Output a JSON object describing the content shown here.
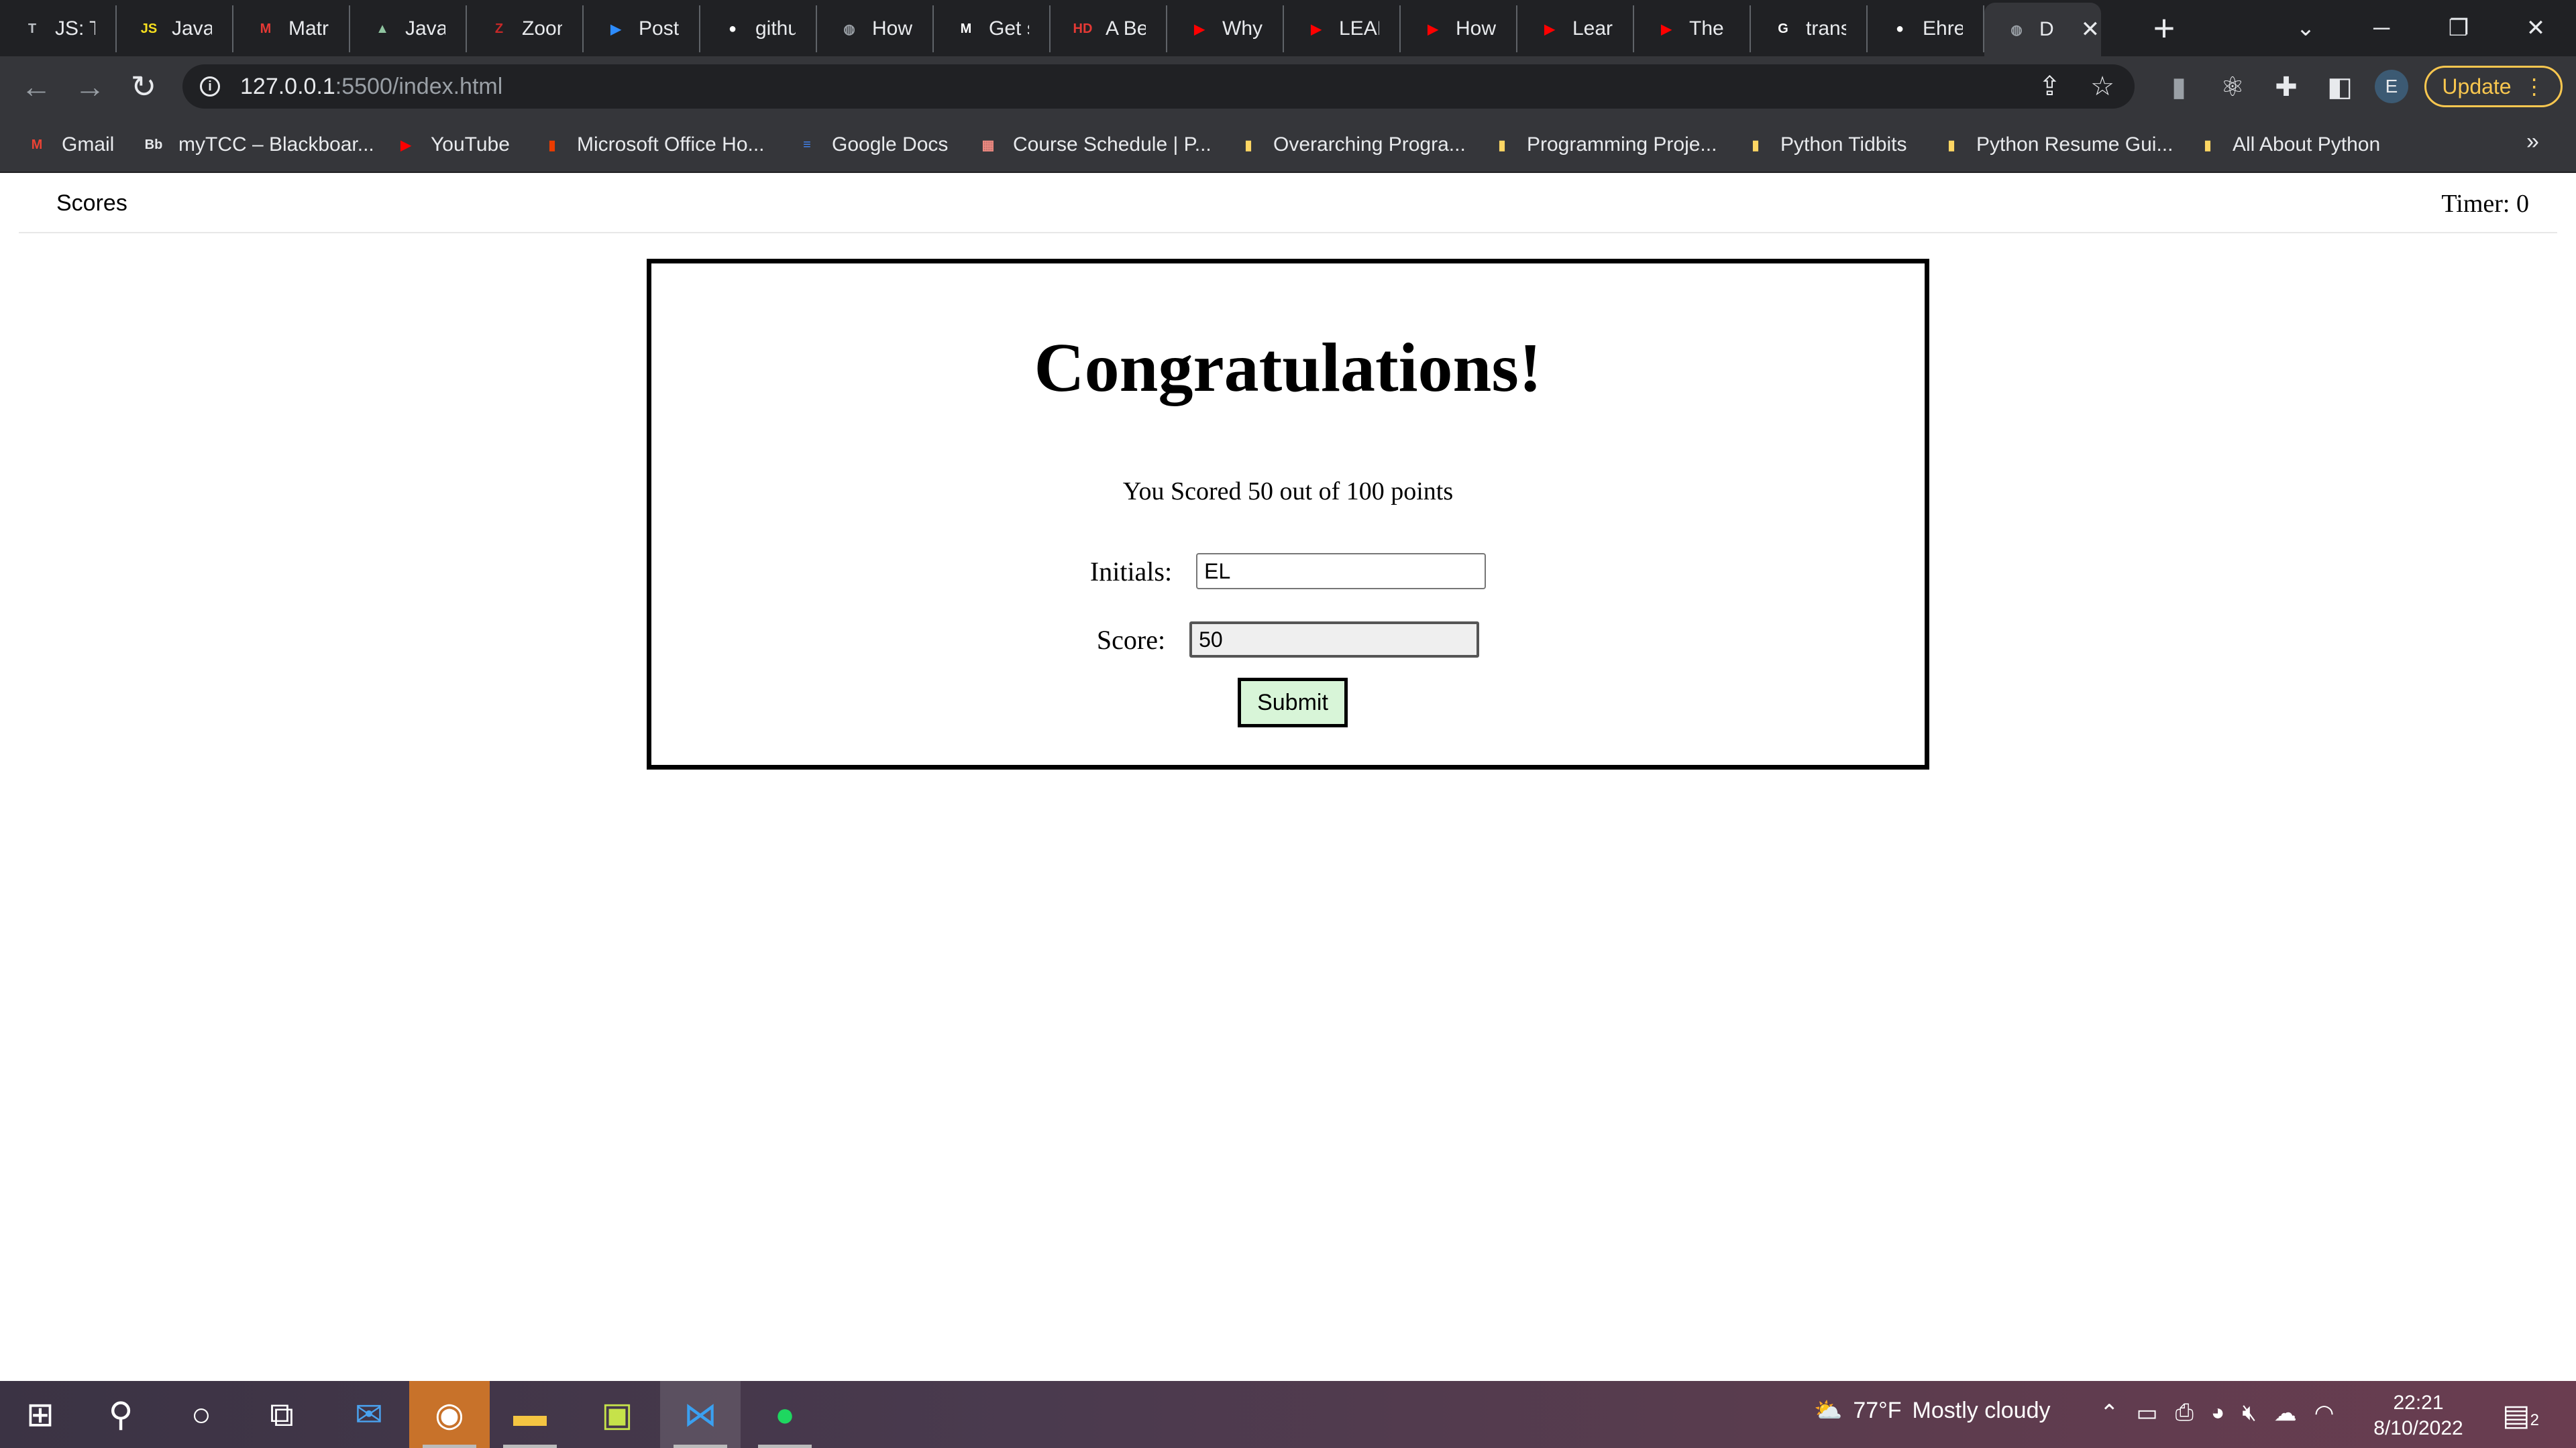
{
  "browser": {
    "tabs": [
      {
        "label": "JS: Tr",
        "icon": "T",
        "icon_color": "#bdc1c6"
      },
      {
        "label": "JavaS",
        "icon": "JS",
        "icon_color": "#f7df1e"
      },
      {
        "label": "Matri",
        "icon": "M",
        "icon_color": "#e53935"
      },
      {
        "label": "JavaS",
        "icon": "▲",
        "icon_color": "#8fc4a0"
      },
      {
        "label": "Zoom",
        "icon": "Z",
        "icon_color": "#c62828"
      },
      {
        "label": "Post /",
        "icon": "▶",
        "icon_color": "#2d8cff"
      },
      {
        "label": "githul",
        "icon": "●",
        "icon_color": "#ffffff"
      },
      {
        "label": "How",
        "icon": "◍",
        "icon_color": "#9aa0a6"
      },
      {
        "label": "Get st",
        "icon": "M",
        "icon_color": "#ffffff"
      },
      {
        "label": "A Beg",
        "icon": "HD",
        "icon_color": "#e53935"
      },
      {
        "label": "Why",
        "icon": "▶",
        "icon_color": "#ff0000"
      },
      {
        "label": "LEARI",
        "icon": "▶",
        "icon_color": "#ff0000"
      },
      {
        "label": "How",
        "icon": "▶",
        "icon_color": "#ff0000"
      },
      {
        "label": "Learn",
        "icon": "▶",
        "icon_color": "#ff0000"
      },
      {
        "label": "The R",
        "icon": "▶",
        "icon_color": "#ff0000"
      },
      {
        "label": "transl",
        "icon": "G",
        "icon_color": "#ffffff"
      },
      {
        "label": "Ehren",
        "icon": "●",
        "icon_color": "#ffffff"
      }
    ],
    "active_tab": {
      "label": "D",
      "icon": "◍"
    },
    "new_tab_symbol": "+",
    "address": {
      "host": "127.0.0.1",
      "path": ":5500/index.html"
    },
    "profile_initial": "E",
    "update_label": "Update",
    "bookmarks": [
      {
        "label": "Gmail",
        "icon": "M",
        "icon_color": "#ea4335"
      },
      {
        "label": "myTCC – Blackboar...",
        "icon": "Bb",
        "icon_color": "#e8eaed"
      },
      {
        "label": "YouTube",
        "icon": "▶",
        "icon_color": "#ff0000"
      },
      {
        "label": "Microsoft Office Ho...",
        "icon": "▮",
        "icon_color": "#eb3c00"
      },
      {
        "label": "Google Docs",
        "icon": "≡",
        "icon_color": "#4285f4"
      },
      {
        "label": "Course Schedule | P...",
        "icon": "▦",
        "icon_color": "#f28b82"
      },
      {
        "label": "Overarching Progra...",
        "icon": "▮",
        "icon_color": "#fdd663"
      },
      {
        "label": "Programming Proje...",
        "icon": "▮",
        "icon_color": "#fdd663"
      },
      {
        "label": "Python Tidbits",
        "icon": "▮",
        "icon_color": "#fdd663"
      },
      {
        "label": "Python Resume Gui...",
        "icon": "▮",
        "icon_color": "#fdd663"
      },
      {
        "label": "All About Python",
        "icon": "▮",
        "icon_color": "#fdd663"
      }
    ],
    "bookmarks_more": "»"
  },
  "page": {
    "scores_link": "Scores",
    "timer": "Timer: 0",
    "heading": "Congratulations!",
    "score_message": "You Scored 50 out of 100 points",
    "initials_label": "Initials:",
    "initials_value": "EL",
    "score_label": "Score:",
    "score_value": "50",
    "submit_label": "Submit"
  },
  "taskbar": {
    "weather_temp": "77°F",
    "weather_text": "Mostly cloudy",
    "time": "22:21",
    "date": "8/10/2022",
    "notification_count": "2"
  }
}
